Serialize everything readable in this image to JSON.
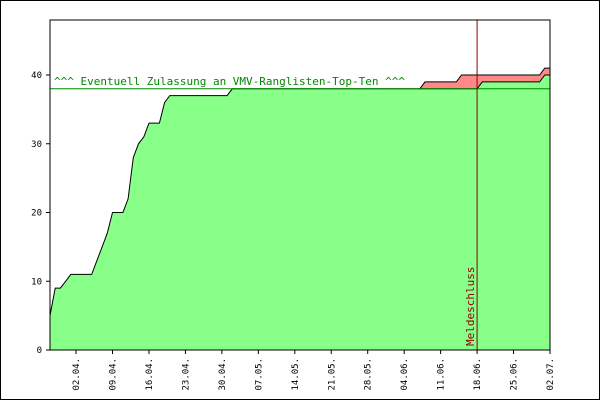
{
  "chart_data": {
    "type": "area",
    "title": "",
    "xlabel": "",
    "ylabel": "",
    "ylim": [
      0,
      48
    ],
    "xlim": [
      "2024-03-28",
      "2024-07-02"
    ],
    "grid": false,
    "legend": "none",
    "x_ticks": [
      "02.04.",
      "09.04.",
      "16.04.",
      "23.04.",
      "30.04.",
      "07.05.",
      "14.05.",
      "21.05.",
      "28.05.",
      "04.06.",
      "11.06.",
      "18.06.",
      "25.06.",
      "02.07."
    ],
    "y_ticks": [
      0,
      10,
      20,
      30,
      40
    ],
    "series": [
      {
        "color": "#ff8888",
        "values": [
          [
            "2024-06-07",
            38
          ],
          [
            "2024-06-08",
            39
          ],
          [
            "2024-06-14",
            39
          ],
          [
            "2024-06-15",
            40
          ],
          [
            "2024-06-30",
            40
          ],
          [
            "2024-07-01",
            41
          ],
          [
            "2024-07-02",
            41
          ]
        ]
      },
      {
        "color": "#88ff88",
        "values": [
          [
            "2024-03-28",
            0
          ],
          [
            "2024-03-28",
            5
          ],
          [
            "2024-03-29",
            9
          ],
          [
            "2024-03-30",
            9
          ],
          [
            "2024-03-31",
            10
          ],
          [
            "2024-04-01",
            11
          ],
          [
            "2024-04-05",
            11
          ],
          [
            "2024-04-06",
            13
          ],
          [
            "2024-04-07",
            15
          ],
          [
            "2024-04-08",
            17
          ],
          [
            "2024-04-09",
            20
          ],
          [
            "2024-04-11",
            20
          ],
          [
            "2024-04-12",
            22
          ],
          [
            "2024-04-13",
            28
          ],
          [
            "2024-04-14",
            30
          ],
          [
            "2024-04-15",
            31
          ],
          [
            "2024-04-16",
            33
          ],
          [
            "2024-04-18",
            33
          ],
          [
            "2024-04-19",
            36
          ],
          [
            "2024-04-20",
            37
          ],
          [
            "2024-05-01",
            37
          ],
          [
            "2024-05-02",
            38
          ],
          [
            "2024-06-18",
            38
          ],
          [
            "2024-06-19",
            39
          ],
          [
            "2024-06-30",
            39
          ],
          [
            "2024-07-01",
            40
          ],
          [
            "2024-07-02",
            40
          ]
        ]
      }
    ],
    "reference_line": {
      "y": 38,
      "label": "^^^ Eventuell Zulassung an VMV-Ranglisten-Top-Ten ^^^",
      "color": "#008800"
    },
    "deadline": {
      "x": "2024-06-18",
      "label": "Meldeschluss",
      "color": "#880000"
    },
    "colors": {
      "frame": "#000000",
      "text": "#000000",
      "outline": "#000000"
    }
  }
}
